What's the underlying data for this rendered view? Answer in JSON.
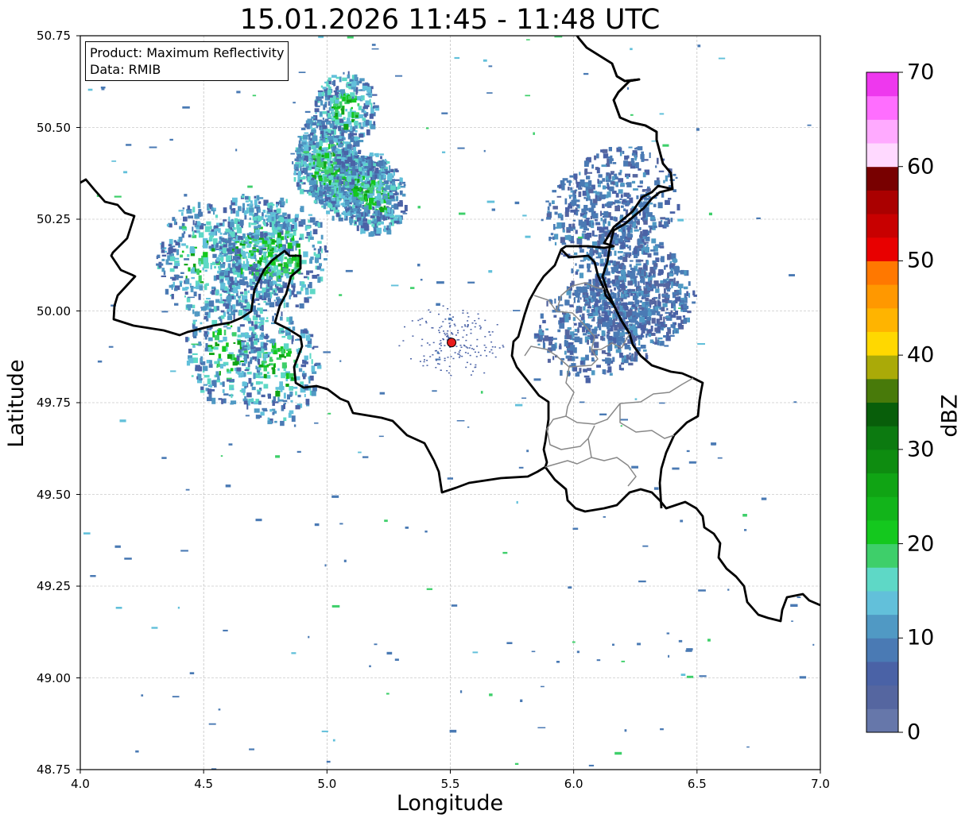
{
  "title": "15.01.2026 11:45 - 11:48 UTC",
  "info": {
    "product": "Product: Maximum Reflectivity",
    "data_source": "Data: RMIB"
  },
  "axes": {
    "xlabel": "Longitude",
    "ylabel": "Latitude",
    "xlim": [
      4.0,
      7.0
    ],
    "ylim": [
      48.75,
      50.75
    ],
    "xticks": [
      "4.0",
      "4.5",
      "5.0",
      "5.5",
      "6.0",
      "6.5",
      "7.0"
    ],
    "yticks": [
      "48.75",
      "49.00",
      "49.25",
      "49.50",
      "49.75",
      "50.00",
      "50.25",
      "50.50",
      "50.75"
    ],
    "grid": true
  },
  "colorbar": {
    "label": "dBZ",
    "range": [
      0,
      70
    ],
    "step": 2.5,
    "ticks": [
      "0",
      "10",
      "20",
      "30",
      "40",
      "50",
      "60",
      "70"
    ],
    "colors": [
      "#6677aa",
      "#5566a0",
      "#4a62a6",
      "#4a7ab4",
      "#5099c4",
      "#62c0da",
      "#5ed8c6",
      "#3ecf6a",
      "#14c81e",
      "#12b41a",
      "#10a414",
      "#0e8c10",
      "#0c7a10",
      "#085e0a",
      "#487a0a",
      "#aaaa08",
      "#ffd800",
      "#ffb400",
      "#ff9800",
      "#ff7800",
      "#e80000",
      "#c80000",
      "#aa0000",
      "#780000",
      "#ffd9ff",
      "#ffaaff",
      "#ff6eff",
      "#ee38ee"
    ]
  },
  "radar_site": {
    "lon": 5.505,
    "lat": 49.914,
    "color": "#e81c1c"
  },
  "echo_regions": [
    {
      "lon": [
        4.35,
        4.95
      ],
      "lat": [
        49.73,
        50.42
      ],
      "intensity": "moderate"
    },
    {
      "lon": [
        4.85,
        5.3
      ],
      "lat": [
        50.22,
        50.68
      ],
      "intensity": "moderate"
    },
    {
      "lon": [
        5.7,
        6.5
      ],
      "lat": [
        49.85,
        50.45
      ],
      "intensity": "light"
    }
  ]
}
